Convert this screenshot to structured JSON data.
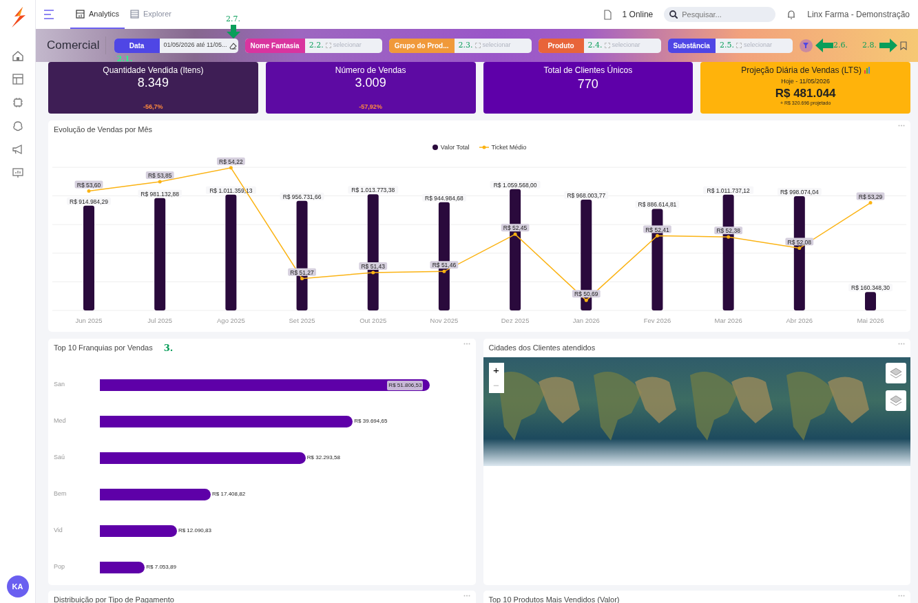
{
  "header": {
    "tabs": [
      {
        "label": "Analytics",
        "selected": true
      },
      {
        "label": "Explorer",
        "selected": false
      }
    ],
    "online": "1 Online",
    "search": {
      "placeholder": "Pesquisar..."
    },
    "tenant": "Linx Farma - Demonstração"
  },
  "user": {
    "initials": "KA"
  },
  "filter_bar": {
    "title": "Comercial",
    "filters": [
      {
        "label": "Data",
        "color": "#4f46e5",
        "value": "01/05/2026 até 11/05...",
        "annotation": "2.1."
      },
      {
        "label": "Nome Fantasia",
        "color": "#d9349f",
        "placeholder": "selecionar",
        "annotation": "2.2."
      },
      {
        "label": "Grupo do Prod...",
        "color": "#f0993a",
        "placeholder": "selecionar",
        "annotation": "2.3."
      },
      {
        "label": "Produto",
        "color": "#e8643a",
        "placeholder": "selecionar",
        "annotation": "2.4."
      },
      {
        "label": "Substância",
        "color": "#4f46e5",
        "placeholder": "selecionar",
        "annotation": "2.5."
      }
    ],
    "clear": {
      "annotation": "2.7."
    },
    "apply": {
      "annotation": "2.6."
    },
    "bookmark": {
      "annotation": "2.8."
    }
  },
  "kpis": [
    {
      "title": "Quantidade Vendida (Itens)",
      "value": "8.349",
      "delta": "-56,7%",
      "color": "#3e1e55"
    },
    {
      "title": "Número de Vendas",
      "value": "3.009",
      "delta": "-57,92%",
      "color": "#5d0aa3"
    },
    {
      "title": "Total de Clientes Únicos",
      "value": "770",
      "color": "#5e00a9"
    },
    {
      "title": "Projeção Diária de Vendas (LTS)",
      "subtitle": "Hoje - 11/05/2026",
      "value": "R$ 481.044",
      "note": "+ R$ 320.696 projetado",
      "color": "#ffb30b"
    }
  ],
  "sales_chart": {
    "title": "Evolução de Vendas por Mês",
    "layers": [
      {
        "chart_data": {
          "type": "bar",
          "categories": [
            "Jun 2025",
            "Jul 2025",
            "Ago 2025",
            "Set 2025",
            "Out 2025",
            "Nov 2025",
            "Dez 2025",
            "Jan 2026",
            "Fev 2026",
            "Mar 2026",
            "Abr 2026",
            "Mai 2026"
          ],
          "ylim": [
            0,
            1250000
          ],
          "series": [
            {
              "name": "Valor Total",
              "color": "#2a0a3c",
              "values": [
                914984.29,
                981132.88,
                1011359.13,
                956731.66,
                1013773.38,
                944984.68,
                1059568.0,
                968003.77,
                886614.81,
                1011737.12,
                998074.04,
                160348.3
              ],
              "value_labels": [
                "R$ 914.984,29",
                "R$ 981.132,88",
                "R$ 1.011.359,13",
                "R$ 956.731,66",
                "R$ 1.013.773,38",
                "R$ 944.984,68",
                "R$ 1.059.568,00",
                "R$ 968.003,77",
                "R$ 886.614,81",
                "R$ 1.011.737,12",
                "R$ 998.074,04",
                "R$ 160.348,30"
              ]
            }
          ]
        }
      },
      {
        "chart_data": {
          "type": "line",
          "series": [
            {
              "name": "Ticket Médio",
              "color": "#fbb313",
              "values": [
                53.6,
                53.85,
                54.22,
                51.27,
                51.43,
                51.46,
                52.45,
                50.69,
                52.41,
                52.38,
                52.08,
                53.29
              ],
              "value_labels": [
                "R$ 53,60",
                "R$ 53,85",
                "R$ 54,22",
                "R$ 51,27",
                "R$ 51,43",
                "R$ 51,46",
                "R$ 52,45",
                "R$ 50,69",
                "R$ 52,41",
                "R$ 52,38",
                "R$ 52,08",
                "R$ 53,29"
              ]
            }
          ]
        }
      }
    ]
  },
  "franchise_chart": {
    "title": "Top 10 Franquias por Vendas",
    "annotation": "3.",
    "chart_data": {
      "type": "bar",
      "orientation": "horizontal",
      "categories": [
        "San",
        "Med",
        "Saú",
        "Bem",
        "Vid",
        "Pop"
      ],
      "values": [
        51806.53,
        39694.65,
        32293.58,
        17408.82,
        12090.83,
        7053.89
      ],
      "value_labels": [
        "R$ 51.806,53",
        "R$ 39.694,65",
        "R$ 32.293,58",
        "R$ 17.408,82",
        "R$ 12.090,83",
        "R$ 7.053,89"
      ]
    }
  },
  "map_card": {
    "title": "Cidades dos Clientes atendidos",
    "zoom_in": "+",
    "zoom_out": "−"
  },
  "bottom_cards": [
    {
      "title": "Distribuição por Tipo de Pagamento"
    },
    {
      "title": "Top 10 Produtos Mais Vendidos (Valor)"
    }
  ]
}
